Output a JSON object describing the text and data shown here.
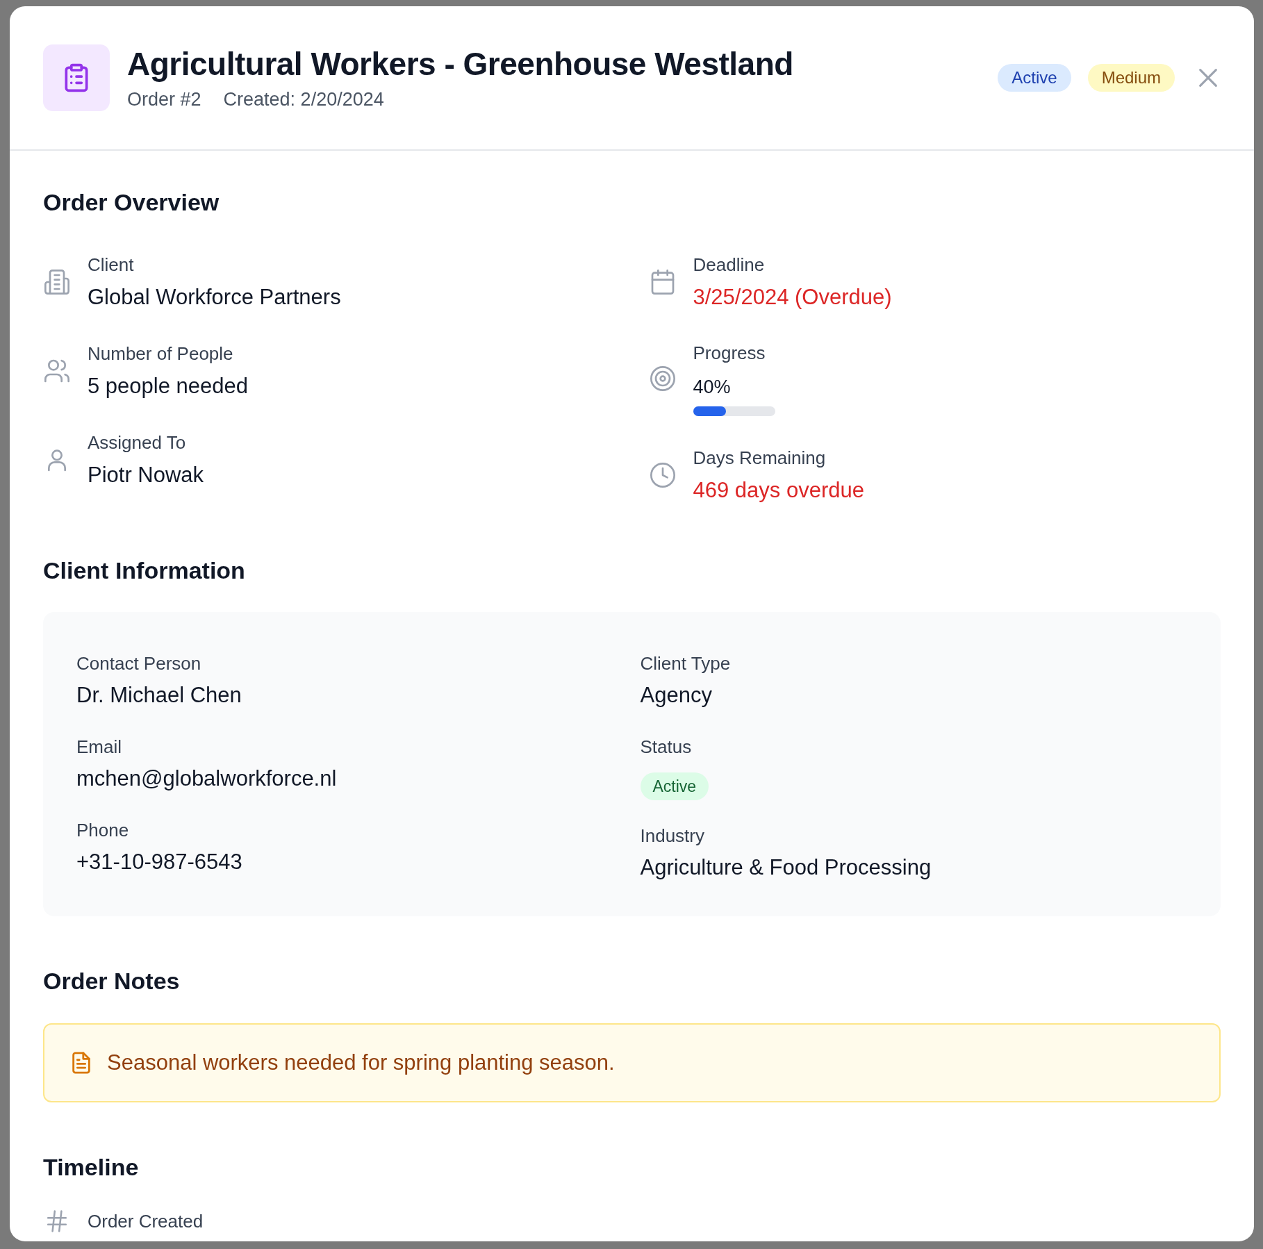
{
  "header": {
    "title": "Agricultural Workers - Greenhouse Westland",
    "order_number": "Order #2",
    "created": "Created: 2/20/2024",
    "badges": [
      {
        "label": "Active",
        "kind": "status"
      },
      {
        "label": "Medium",
        "kind": "priority"
      }
    ]
  },
  "overview": {
    "title": "Order Overview",
    "left_column": [
      {
        "label": "Client",
        "value": "Global Workforce Partners",
        "kind": "text"
      },
      {
        "label": "Number of People",
        "value": "5 people needed",
        "kind": "text"
      },
      {
        "label": "Assigned To",
        "value": "Piotr Nowak",
        "kind": "text"
      }
    ],
    "right_column": [
      {
        "label": "Deadline",
        "value": "3/25/2024 (Overdue)",
        "kind": "alert"
      },
      {
        "label": "Progress",
        "value": "40%",
        "kind": "progress",
        "level": 0.4
      },
      {
        "label": "Days Remaining",
        "value": "469 days overdue",
        "kind": "alert"
      }
    ]
  },
  "client_information": {
    "title": "Client Information",
    "left_column": [
      {
        "label": "Contact Person",
        "value": "Dr. Michael Chen",
        "kind": "text"
      },
      {
        "label": "Email",
        "value": "mchen@globalworkforce.nl",
        "kind": "text"
      },
      {
        "label": "Phone",
        "value": "+31-10-987-6543",
        "kind": "text"
      }
    ],
    "right_column": [
      {
        "label": "Client Type",
        "value": "Agency",
        "kind": "text"
      },
      {
        "label": "Status",
        "value": "Active",
        "kind": "badge"
      },
      {
        "label": "Industry",
        "value": "Agriculture & Food Processing",
        "kind": "text"
      }
    ]
  },
  "order_notes": {
    "title": "Order Notes",
    "text": "Seasonal workers needed for spring planting season."
  },
  "timeline": {
    "title": "Timeline",
    "events": [
      {
        "label": "Order Created"
      }
    ]
  }
}
